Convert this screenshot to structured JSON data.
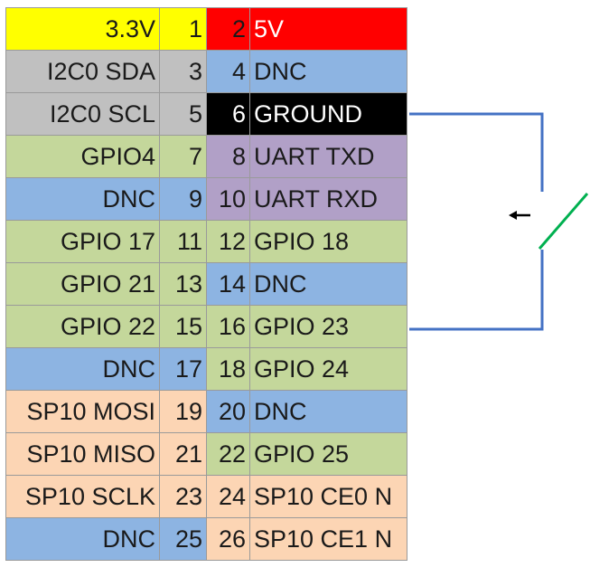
{
  "colors": {
    "power33": "#FFFF00",
    "power5": "#FF0000",
    "ground": "#000000",
    "gray": "#C0C0C0",
    "green": "#C4D79B",
    "blue": "#8DB4E2",
    "purple": "#B1A0C7",
    "peach": "#FCD5B4",
    "wire": "#4472C4",
    "switch": "#00B050"
  },
  "rows": [
    {
      "left": "3.3V",
      "lnum": "1",
      "rnum": "2",
      "right": "5V",
      "lc": "power33",
      "rc": "power5"
    },
    {
      "left": "I2C0 SDA",
      "lnum": "3",
      "rnum": "4",
      "right": "DNC",
      "lc": "gray",
      "rc": "blue"
    },
    {
      "left": "I2C0 SCL",
      "lnum": "5",
      "rnum": "6",
      "right": "GROUND",
      "lc": "gray",
      "rc": "ground"
    },
    {
      "left": "GPIO4",
      "lnum": "7",
      "rnum": "8",
      "right": "UART TXD",
      "lc": "green",
      "rc": "purple"
    },
    {
      "left": "DNC",
      "lnum": "9",
      "rnum": "10",
      "right": "UART RXD",
      "lc": "blue",
      "rc": "purple"
    },
    {
      "left": "GPIO 17",
      "lnum": "11",
      "rnum": "12",
      "right": "GPIO 18",
      "lc": "green",
      "rc": "green"
    },
    {
      "left": "GPIO 21",
      "lnum": "13",
      "rnum": "14",
      "right": "DNC",
      "lc": "green",
      "rc": "blue"
    },
    {
      "left": "GPIO 22",
      "lnum": "15",
      "rnum": "16",
      "right": "GPIO 23",
      "lc": "green",
      "rc": "green"
    },
    {
      "left": "DNC",
      "lnum": "17",
      "rnum": "18",
      "right": "GPIO 24",
      "lc": "blue",
      "rc": "green"
    },
    {
      "left": "SP10 MOSI",
      "lnum": "19",
      "rnum": "20",
      "right": "DNC",
      "lc": "peach",
      "rc": "blue"
    },
    {
      "left": "SP10 MISO",
      "lnum": "21",
      "rnum": "22",
      "right": "GPIO 25",
      "lc": "peach",
      "rc": "green"
    },
    {
      "left": "SP10 SCLK",
      "lnum": "23",
      "rnum": "24",
      "right": "SP10 CE0 N",
      "lc": "peach",
      "rc": "peach"
    },
    {
      "left": "DNC",
      "lnum": "25",
      "rnum": "26",
      "right": "SP10 CE1 N",
      "lc": "blue",
      "rc": "peach"
    }
  ],
  "switch": {
    "from_pin": "6",
    "to_pin": "16",
    "icon": "push-switch-icon",
    "arrow_icon": "arrow-left-icon"
  }
}
